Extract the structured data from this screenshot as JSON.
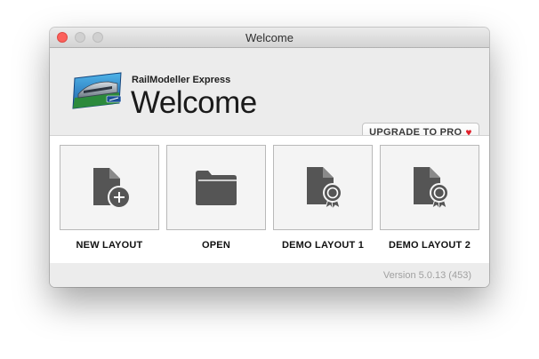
{
  "window": {
    "title": "Welcome"
  },
  "header": {
    "product_name": "RailModeller Express",
    "heading": "Welcome",
    "upgrade_label": "UPGRADE TO PRO",
    "logo_icon": "railmodeller-express-logo-icon"
  },
  "tiles": [
    {
      "label": "NEW LAYOUT",
      "icon": "new-document-icon"
    },
    {
      "label": "OPEN",
      "icon": "folder-icon"
    },
    {
      "label": "DEMO LAYOUT 1",
      "icon": "demo-document-badge-icon"
    },
    {
      "label": "DEMO LAYOUT 2",
      "icon": "demo-document-badge-icon"
    }
  ],
  "footer": {
    "version": "Version 5.0.13 (453)"
  },
  "colors": {
    "icon_fill": "#555555",
    "heart": "#e0202a",
    "close_button": "#fc605b"
  }
}
